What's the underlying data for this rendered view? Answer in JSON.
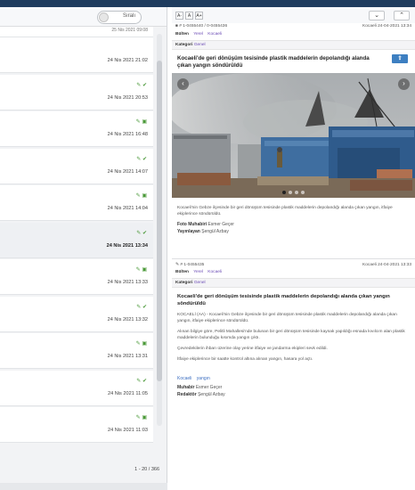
{
  "left": {
    "toggle_label": "Sıralı",
    "first_date": "25 Nis 2021 09:08",
    "items": [
      {
        "date": "24 Nis 2021 21:02",
        "icons": ""
      },
      {
        "date": "24 Nis 2021 20:53",
        "icons": "✎ ✔"
      },
      {
        "date": "24 Nis 2021 16:48",
        "icons": "✎ ▣"
      },
      {
        "date": "24 Nis 2021 14:07",
        "icons": "✎ ✔"
      },
      {
        "date": "24 Nis 2021 14:04",
        "icons": "✎ ▣"
      },
      {
        "date": "24 Nis 2021 13:34",
        "icons": "✎ ✔"
      },
      {
        "date": "24 Nis 2021 13:33",
        "icons": "✎ ▣"
      },
      {
        "date": "24 Nis 2021 13:32",
        "icons": "✎ ✔"
      },
      {
        "date": "24 Nis 2021 13:31",
        "icons": "✎ ▣"
      },
      {
        "date": "24 Nis 2021 11:05",
        "icons": "✎ ✔"
      },
      {
        "date": "24 Nis 2021 11:03",
        "icons": "✎ ▣"
      }
    ],
    "pager": "1 - 20 / 366"
  },
  "right": {
    "font_buttons": [
      "A-",
      "A",
      "A+"
    ],
    "nav_down": "⌄",
    "nav_up": "⌃",
    "meta1": {
      "ids": "# 1-0455440 / 0-0455436",
      "location": "Kocaeli 24-04-2021 13:34"
    },
    "tags1": {
      "label": "Bülten",
      "values": [
        "Yerel",
        "Kocaeli"
      ]
    },
    "kategori": {
      "label": "Kategori",
      "value": "Genel"
    },
    "headline1": "Kocaeli'de geri dönüşüm tesisinde plastik maddelerin depolandığı alanda çıkan yangın söndürüldü",
    "share_icon": "⇪",
    "caption": "Kocaeli'nin Gebze ilçesinde bir geri dönüşüm tesisinde plastik maddelerin depolandığı alanda çıkan yangın, itfaiye ekiplerince söndürüldü.",
    "photo_credit": {
      "label": "Foto Muhabiri",
      "value": "Esmer Geçer"
    },
    "publisher": {
      "label": "Yayınlayan",
      "value": "Şengül Azbay"
    },
    "meta2": {
      "ids": "# 1-0455435",
      "location": "Kocaeli 24-04-2021 13:33"
    },
    "tags2": {
      "label": "Bülten",
      "values": [
        "Yerel",
        "Kocaeli"
      ]
    },
    "kategori2": {
      "label": "Kategori",
      "value": "Genel"
    },
    "headline2": "Kocaeli'de geri dönüşüm tesisinde plastik maddelerin depolandığı alanda çıkan yangın söndürüldü",
    "paragraphs": [
      "KOCAELİ (AA) - Kocaeli'nin Gebze ilçesinde bir geri dönüşüm tesisinde plastik maddelerin depolandığı alanda çıkan yangın, itfaiye ekiplerince söndürüldü.",
      "Alınan bilgiye göre, Pelitli Mahallesi'nde bulunan bir geri dönüşüm tesisinde kaynak yapıldığı esnada kıvılcım alan plastik maddelerin bulunduğu kısımda yangın çıktı.",
      "Çevredekilerin ihbarı üzerine olay yerine itfaiye ve jandarma ekipleri sevk edildi.",
      "İtfaiye ekiplerince bir saatte kontrol altına alınan yangın, hasara yol açtı."
    ],
    "keywords": [
      "Kocaeli",
      "yangın"
    ],
    "muhabir": {
      "label": "Muhabir",
      "value": "Esmer Geçer"
    },
    "editor": {
      "label": "Redaktör",
      "value": "Şengül Azbay"
    }
  }
}
